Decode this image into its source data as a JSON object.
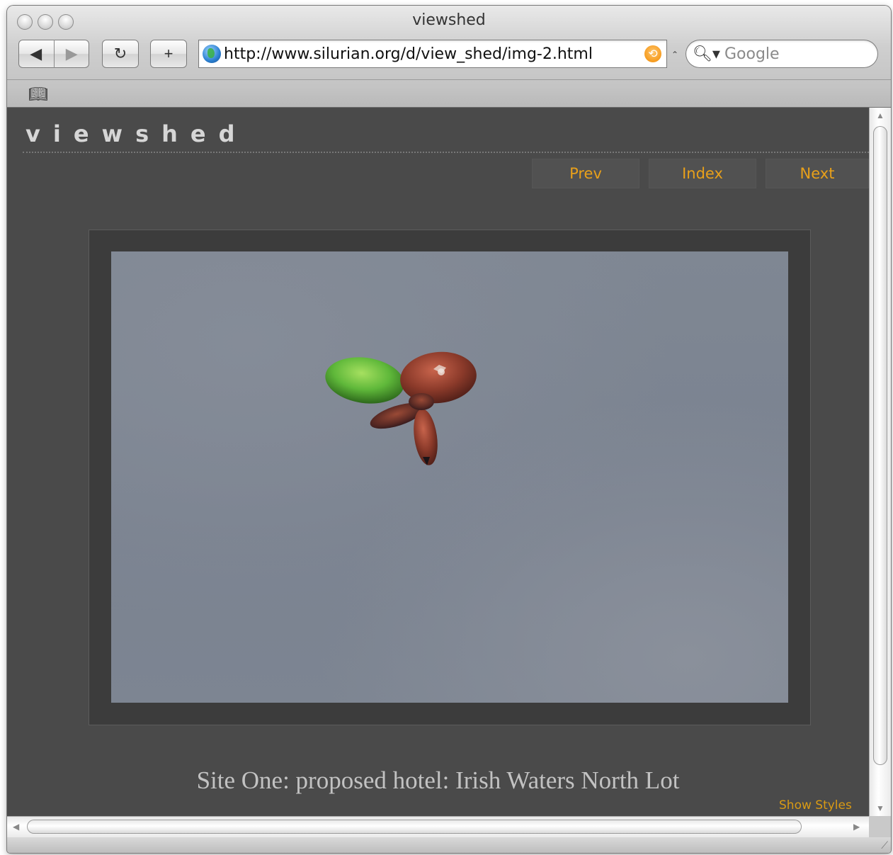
{
  "window": {
    "title": "viewshed"
  },
  "toolbar": {
    "url": "http://www.silurian.org/d/view_shed/img-2.html",
    "search_placeholder": "Google",
    "back_icon": "back-arrow-icon",
    "forward_icon": "forward-arrow-icon",
    "reload_icon": "reload-icon",
    "add_icon": "plus-icon",
    "feed_icon": "rss-icon",
    "bookmarks_icon": "book-icon"
  },
  "page": {
    "site_title": "viewshed",
    "nav": {
      "prev": "Prev",
      "index": "Index",
      "next": "Next"
    },
    "caption": "Site One: proposed hotel: Irish Waters North Lot",
    "show_styles": "Show Styles"
  },
  "colors": {
    "page_background": "#4a4a4a",
    "link_accent": "#e8a01a",
    "sky": "#7d8592",
    "balloon_green": "#5fb83a",
    "balloon_red": "#8b3a2a"
  }
}
